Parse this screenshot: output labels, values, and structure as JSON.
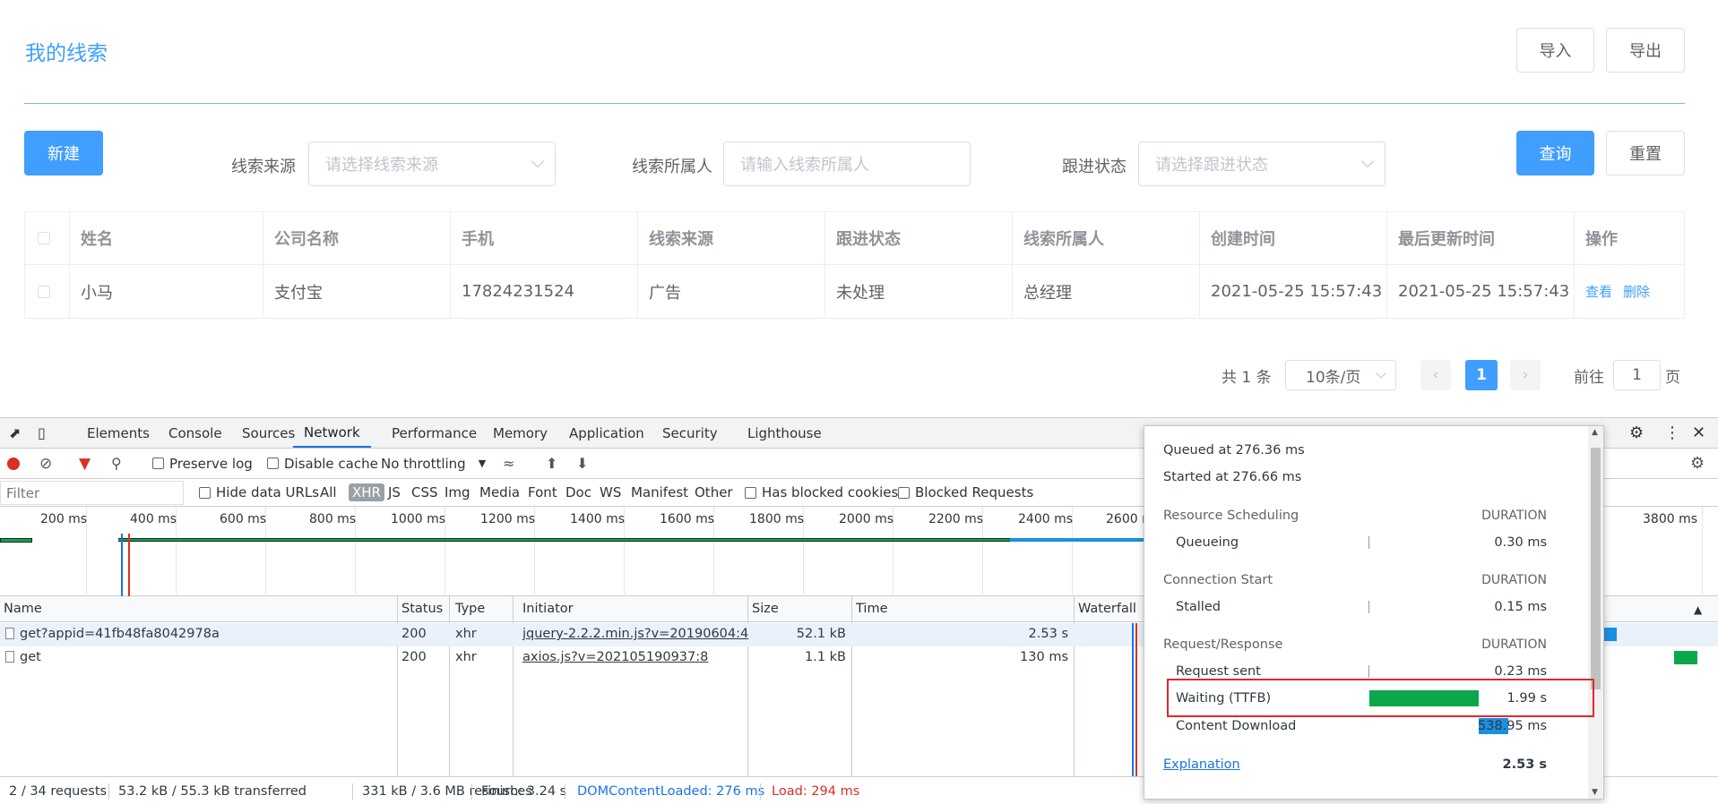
{
  "app": {
    "title": "我的线索",
    "import_label": "导入",
    "export_label": "导出",
    "new_label": "新建",
    "search_label": "查询",
    "reset_label": "重置",
    "filters": {
      "source_label": "线索来源",
      "source_placeholder": "请选择线索来源",
      "owner_label": "线索所属人",
      "owner_placeholder": "请输入线索所属人",
      "status_label": "跟进状态",
      "status_placeholder": "请选择跟进状态"
    },
    "table": {
      "headers": [
        "姓名",
        "公司名称",
        "手机",
        "线索来源",
        "跟进状态",
        "线索所属人",
        "创建时间",
        "最后更新时间",
        "操作"
      ],
      "rows": [
        {
          "name": "小马",
          "company": "支付宝",
          "phone": "17824231524",
          "source": "广告",
          "status": "未处理",
          "owner": "总经理",
          "created": "2021-05-25 15:57:43",
          "updated": "2021-05-25 15:57:43",
          "view": "查看",
          "delete": "删除"
        }
      ]
    },
    "pagination": {
      "total": "共 1 条",
      "page_size": "10条/页",
      "current_page": "1",
      "goto_label": "前往",
      "goto_value": "1",
      "page_suffix": "页"
    }
  },
  "devtools": {
    "tabs": [
      "Elements",
      "Console",
      "Sources",
      "Network",
      "Performance",
      "Memory",
      "Application",
      "Security",
      "Lighthouse"
    ],
    "active_tab": "Network",
    "toolbar": {
      "preserve_log": "Preserve log",
      "disable_cache": "Disable cache",
      "throttling": "No throttling"
    },
    "filterbar": {
      "filter_placeholder": "Filter",
      "hide_data_urls": "Hide data URLs",
      "types": [
        "All",
        "XHR",
        "JS",
        "CSS",
        "Img",
        "Media",
        "Font",
        "Doc",
        "WS",
        "Manifest",
        "Other"
      ],
      "active_type": "XHR",
      "has_blocked_cookies": "Has blocked cookies",
      "blocked_requests": "Blocked Requests"
    },
    "overview_ticks": [
      "200 ms",
      "400 ms",
      "600 ms",
      "800 ms",
      "1000 ms",
      "1200 ms",
      "1400 ms",
      "1600 ms",
      "1800 ms",
      "2000 ms",
      "2200 ms",
      "2400 ms",
      "2600 ms",
      "3800 ms"
    ],
    "columns": [
      "Name",
      "Status",
      "Type",
      "Initiator",
      "Size",
      "Time",
      "Waterfall"
    ],
    "requests": [
      {
        "name": "get?appid=41fb48fa8042978a",
        "status": "200",
        "type": "xhr",
        "initiator": "jquery-2.2.2.min.js?v=20190604:4",
        "size": "52.1 kB",
        "time": "2.53 s"
      },
      {
        "name": "get",
        "status": "200",
        "type": "xhr",
        "initiator": "axios.js?v=202105190937:8",
        "size": "1.1 kB",
        "time": "130 ms"
      }
    ],
    "status": {
      "requests": "2 / 34 requests",
      "transferred": "53.2 kB / 55.3 kB transferred",
      "resources": "331 kB / 3.6 MB resources",
      "finish": "Finish: 3.24 s",
      "dom_content_loaded": "DOMContentLoaded: 276 ms",
      "load": "Load: 294 ms"
    },
    "timing": {
      "queued": "Queued at 276.36 ms",
      "started": "Started at 276.66 ms",
      "duration_label": "DURATION",
      "sections": [
        {
          "title": "Resource Scheduling",
          "items": [
            {
              "label": "Queueing",
              "value": "0.30 ms"
            }
          ]
        },
        {
          "title": "Connection Start",
          "items": [
            {
              "label": "Stalled",
              "value": "0.15 ms"
            }
          ]
        },
        {
          "title": "Request/Response",
          "items": [
            {
              "label": "Request sent",
              "value": "0.23 ms"
            },
            {
              "label": "Waiting (TTFB)",
              "value": "1.99 s"
            },
            {
              "label": "Content Download",
              "value": "538.95 ms"
            }
          ]
        }
      ],
      "explanation": "Explanation",
      "total": "2.53 s"
    },
    "colors": {
      "ttfb": "#0ba74b",
      "download": "#1a90e0",
      "accent": "#1a73e8",
      "load": "#d93025",
      "dcl": "#1a73e8"
    }
  }
}
